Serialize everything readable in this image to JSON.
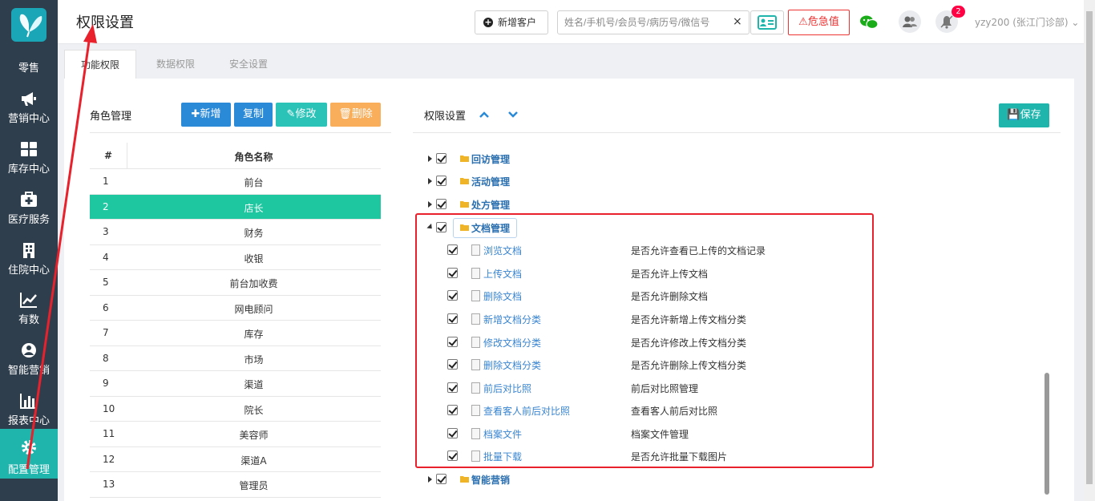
{
  "sidebar": {
    "items": [
      {
        "label": "零售",
        "icon": "retail-icon"
      },
      {
        "label": "营销中心",
        "icon": "megaphone-icon"
      },
      {
        "label": "库存中心",
        "icon": "grid-icon"
      },
      {
        "label": "医疗服务",
        "icon": "medical-kit-icon"
      },
      {
        "label": "住院中心",
        "icon": "building-icon"
      },
      {
        "label": "有数",
        "icon": "trend-chart-icon"
      },
      {
        "label": "智能营销",
        "icon": "smart-marketing-icon"
      },
      {
        "label": "报表中心",
        "icon": "bar-chart-icon"
      },
      {
        "label": "配置管理",
        "icon": "gear-icon",
        "active": true
      }
    ]
  },
  "header": {
    "title": "权限设置",
    "new_customer_label": "新增客户",
    "search_placeholder": "姓名/手机号/会员号/病历号/微信号",
    "clear_label": "×",
    "danger_label": "危急值",
    "notification_count": "2",
    "user_label": "yzy200 (张江门诊部)"
  },
  "tabs": [
    {
      "label": "功能权限",
      "active": true
    },
    {
      "label": "数据权限"
    },
    {
      "label": "安全设置"
    }
  ],
  "roles": {
    "title": "角色管理",
    "add_label": "新增",
    "copy_label": "复制",
    "edit_label": "修改",
    "delete_label": "删除",
    "col_index": "#",
    "col_name": "角色名称",
    "rows": [
      {
        "no": "1",
        "name": "前台"
      },
      {
        "no": "2",
        "name": "店长",
        "selected": true
      },
      {
        "no": "3",
        "name": "财务"
      },
      {
        "no": "4",
        "name": "收银"
      },
      {
        "no": "5",
        "name": "前台加收费"
      },
      {
        "no": "6",
        "name": "网电顾问"
      },
      {
        "no": "7",
        "name": "库存"
      },
      {
        "no": "8",
        "name": "市场"
      },
      {
        "no": "9",
        "name": "渠道"
      },
      {
        "no": "10",
        "name": "院长"
      },
      {
        "no": "11",
        "name": "美容师"
      },
      {
        "no": "12",
        "name": "渠道A"
      },
      {
        "no": "13",
        "name": "管理员"
      }
    ]
  },
  "permissions": {
    "title": "权限设置",
    "save_label": "保存",
    "tree_before": [
      {
        "label": "回访管理",
        "checked": true
      },
      {
        "label": "活动管理",
        "checked": true
      },
      {
        "label": "处方管理",
        "checked": true
      }
    ],
    "expanded": {
      "label": "文档管理",
      "checked": true,
      "children": [
        {
          "label": "浏览文档",
          "desc": "是否允许查看已上传的文档记录",
          "checked": true
        },
        {
          "label": "上传文档",
          "desc": "是否允许上传文档",
          "checked": true
        },
        {
          "label": "删除文档",
          "desc": "是否允许删除文档",
          "checked": true
        },
        {
          "label": "新增文档分类",
          "desc": "是否允许新增上传文档分类",
          "checked": true
        },
        {
          "label": "修改文档分类",
          "desc": "是否允许修改上传文档分类",
          "checked": true
        },
        {
          "label": "删除文档分类",
          "desc": "是否允许删除上传文档分类",
          "checked": true
        },
        {
          "label": "前后对比照",
          "desc": "前后对比照管理",
          "checked": true
        },
        {
          "label": "查看客人前后对比照",
          "desc": "查看客人前后对比照",
          "checked": true
        },
        {
          "label": "档案文件",
          "desc": "档案文件管理",
          "checked": true
        },
        {
          "label": "批量下载",
          "desc": "是否允许批量下载图片",
          "checked": true
        }
      ]
    },
    "tree_after": [
      {
        "label": "智能营销",
        "checked": true
      }
    ]
  },
  "colors": {
    "sidebar_bg": "#2f3e4c",
    "accent_teal": "#1fb5ad",
    "selected_row": "#1fc7a0",
    "primary_blue": "#2a8ad8",
    "orange": "#f8ae5b",
    "annotation_red": "#e8212c"
  }
}
